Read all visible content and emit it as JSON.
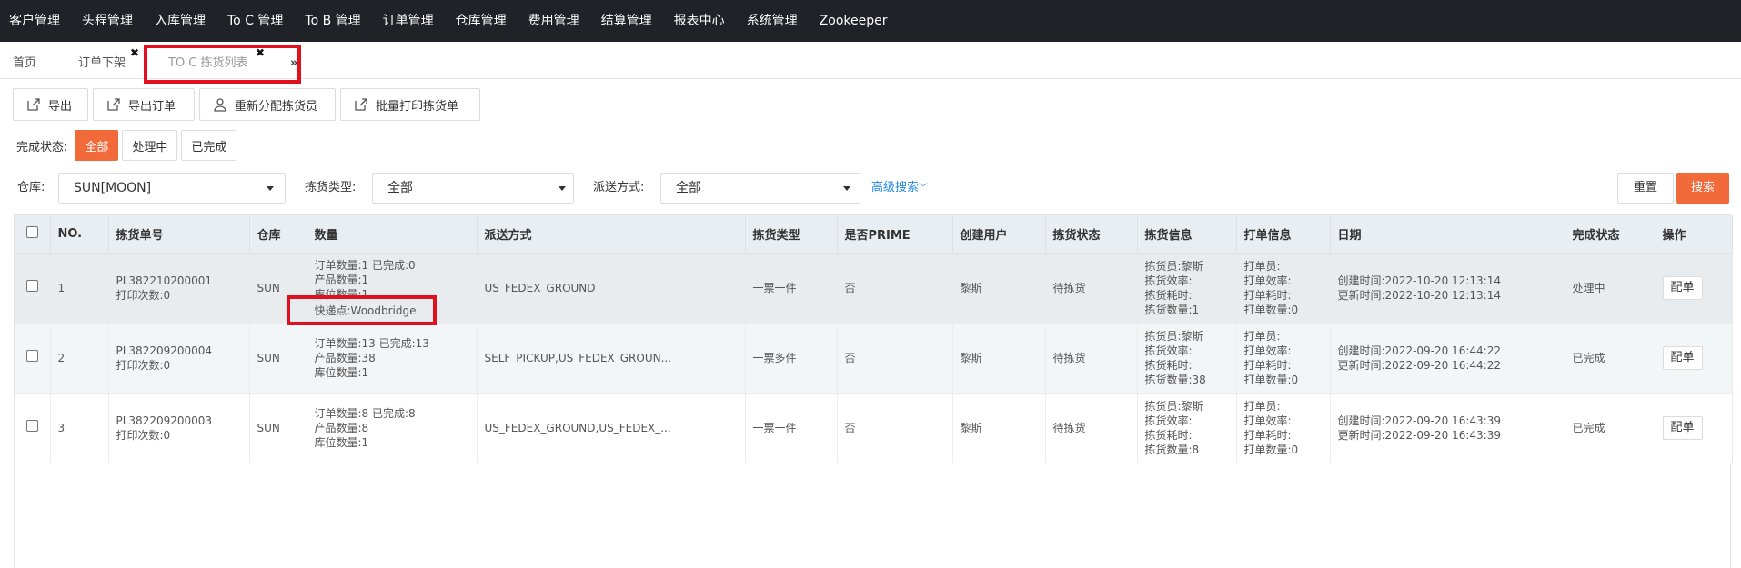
{
  "topnav": [
    "客户管理",
    "头程管理",
    "入库管理",
    "To C 管理",
    "To B 管理",
    "订单管理",
    "仓库管理",
    "费用管理",
    "结算管理",
    "报表中心",
    "系统管理",
    "Zookeeper"
  ],
  "tabs": {
    "home": "首页",
    "order_down": "订单下架",
    "pick_list": "TO C 拣货列表",
    "more": "»"
  },
  "toolbar": {
    "export": "导出",
    "export_order": "导出订单",
    "reassign": "重新分配拣货员",
    "batch_print": "批量打印拣货单"
  },
  "status_filter": {
    "label": "完成状态:",
    "options": [
      "全部",
      "处理中",
      "已完成"
    ],
    "active": "全部"
  },
  "filters": {
    "warehouse_label": "仓库:",
    "warehouse_value": "SUN[MOON]",
    "pick_type_label": "拣货类型:",
    "pick_type_value": "全部",
    "ship_label": "派送方式:",
    "ship_value": "全部",
    "advanced": "高级搜索",
    "reset": "重置",
    "search": "搜索"
  },
  "table": {
    "headers": [
      "NO.",
      "拣货单号",
      "仓库",
      "数量",
      "派送方式",
      "拣货类型",
      "是否PRIME",
      "创建用户",
      "拣货状态",
      "拣货信息",
      "打单信息",
      "日期",
      "完成状态",
      "操作"
    ],
    "rows": [
      {
        "no": "1",
        "pick_no": "PL382210200001",
        "print_count": "打印次数:0",
        "warehouse": "SUN",
        "qty": [
          "订单数量:1 已完成:0",
          "产品数量:1",
          "库位数量:1",
          "快递点:Woodbridge"
        ],
        "ship": "US_FEDEX_GROUND",
        "pick_type": "一票一件",
        "prime": "否",
        "user": "黎斯",
        "pick_status": "待拣货",
        "pick_info": [
          "拣货员:黎斯",
          "拣货效率:",
          "拣货耗时:",
          "拣货数量:1"
        ],
        "print_info": [
          "打单员:",
          "打单效率:",
          "打单耗时:",
          "打单数量:0"
        ],
        "date": [
          "创建时间:2022-10-20 12:13:14",
          "更新时间:2022-10-20 12:13:14"
        ],
        "done": "处理中",
        "op": "配单"
      },
      {
        "no": "2",
        "pick_no": "PL382209200004",
        "print_count": "打印次数:0",
        "warehouse": "SUN",
        "qty": [
          "订单数量:13 已完成:13",
          "产品数量:38",
          "库位数量:1"
        ],
        "ship": "SELF_PICKUP,US_FEDEX_GROUN...",
        "pick_type": "一票多件",
        "prime": "否",
        "user": "黎斯",
        "pick_status": "待拣货",
        "pick_info": [
          "拣货员:黎斯",
          "拣货效率:",
          "拣货耗时:",
          "拣货数量:38"
        ],
        "print_info": [
          "打单员:",
          "打单效率:",
          "打单耗时:",
          "打单数量:0"
        ],
        "date": [
          "创建时间:2022-09-20 16:44:22",
          "更新时间:2022-09-20 16:44:22"
        ],
        "done": "已完成",
        "op": "配单"
      },
      {
        "no": "3",
        "pick_no": "PL382209200003",
        "print_count": "打印次数:0",
        "warehouse": "SUN",
        "qty": [
          "订单数量:8 已完成:8",
          "产品数量:8",
          "库位数量:1"
        ],
        "ship": "US_FEDEX_GROUND,US_FEDEX_...",
        "pick_type": "一票一件",
        "prime": "否",
        "user": "黎斯",
        "pick_status": "待拣货",
        "pick_info": [
          "拣货员:黎斯",
          "拣货效率:",
          "拣货耗时:",
          "拣货数量:8"
        ],
        "print_info": [
          "打单员:",
          "打单效率:",
          "打单耗时:",
          "打单数量:0"
        ],
        "date": [
          "创建时间:2022-09-20 16:43:39",
          "更新时间:2022-09-20 16:43:39"
        ],
        "done": "已完成",
        "op": "配单"
      }
    ]
  },
  "colors": {
    "accent": "#f26a3a",
    "nav_bg": "#1f2226",
    "highlight": "#e0101e",
    "link": "#1e88e5"
  }
}
